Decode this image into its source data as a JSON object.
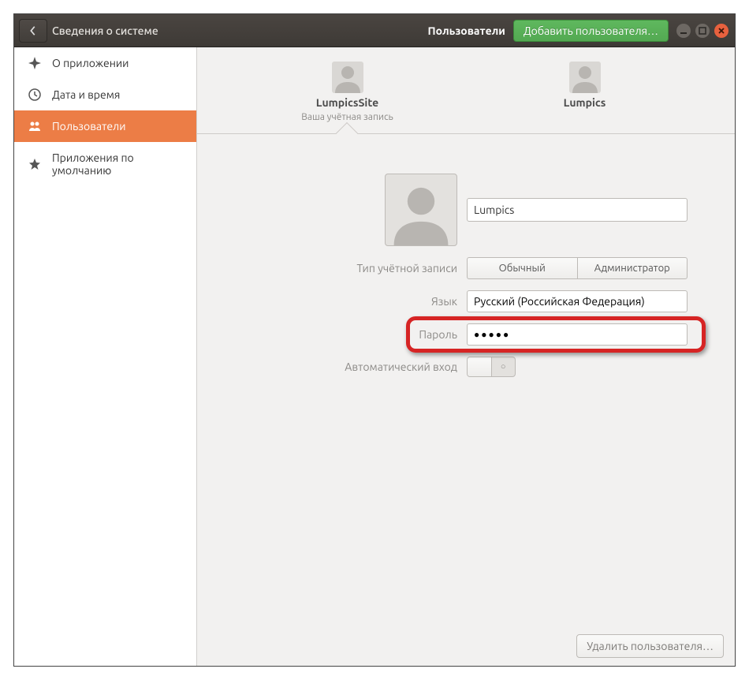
{
  "titlebar": {
    "back_title": "Сведения о системе",
    "section": "Пользователи",
    "add_user": "Добавить пользователя…"
  },
  "sidebar": {
    "items": [
      {
        "label": "О приложении"
      },
      {
        "label": "Дата и время"
      },
      {
        "label": "Пользователи"
      },
      {
        "label": "Приложения по умолчанию"
      }
    ]
  },
  "users_tabs": {
    "current": {
      "name": "LumpicsSite",
      "subtitle": "Ваша учётная запись"
    },
    "other": {
      "name": "Lumpics"
    }
  },
  "form": {
    "name_value": "Lumpics",
    "account_type_label": "Тип учётной записи",
    "account_type_standard": "Обычный",
    "account_type_admin": "Администратор",
    "language_label": "Язык",
    "language_value": "Русский (Российская Федерация)",
    "password_label": "Пароль",
    "password_value": "●●●●●",
    "autologin_label": "Автоматический вход",
    "switch_off": "○"
  },
  "footer": {
    "delete_user": "Удалить пользователя…"
  }
}
